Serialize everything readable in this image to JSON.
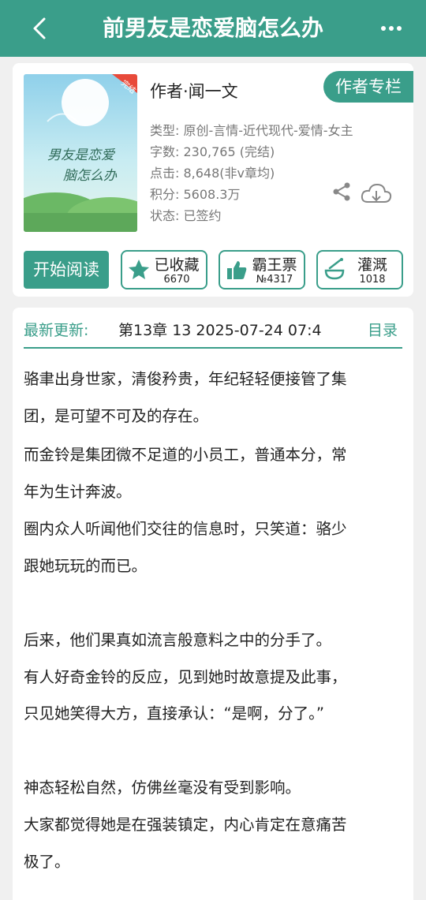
{
  "topbar": {
    "title": "前男友是恋爱脑怎么办"
  },
  "book": {
    "author_line": "作者·闻一文",
    "author_tag": "作者专栏",
    "cover_badge": "完结",
    "cover_title_line1": "男友是恋爱",
    "cover_title_line2": "脑怎么办",
    "meta": {
      "type": "类型: 原创-言情-近代现代-爱情-女主",
      "words": "字数: 230,765 (完结)",
      "clicks": "点击: 8,648(非v章均)",
      "score": "积分: 5608.3万",
      "status": "状态: 已签约"
    }
  },
  "actions": {
    "read": "开始阅读",
    "collect": {
      "label": "已收藏",
      "count": "6670"
    },
    "vote": {
      "label": "霸王票",
      "count": "№4317"
    },
    "water": {
      "label": "灌溉",
      "count": "1018"
    }
  },
  "update": {
    "label": "最新更新:",
    "text": "第13章  13  2025-07-24 07:4",
    "toc": "目录"
  },
  "synopsis": [
    "骆聿出身世家，清俊矜贵，年纪轻轻便接管了集",
    "团，是可望不可及的存在。",
    "而金铃是集团微不足道的小员工，普通本分，常",
    "年为生计奔波。",
    "圈内众人听闻他们交往的信息时，只笑道：骆少",
    "跟她玩玩的而已。",
    "",
    "后来，他们果真如流言般意料之中的分手了。",
    "有人好奇金铃的反应，见到她时故意提及此事，",
    "只见她笑得大方，直接承认：“是啊，分了。”",
    "",
    "神态轻松自然，仿佛丝毫没有受到影响。",
    "大家都觉得她是在强装镇定，内心肯定在意痛苦",
    "极了。"
  ],
  "colors": {
    "accent": "#3a9e8a",
    "cover_badge": "#e84a3a"
  },
  "icons": [
    "back-icon",
    "more-icon",
    "share-icon",
    "download-icon",
    "star-icon",
    "thumb-up-icon",
    "watering-icon"
  ]
}
